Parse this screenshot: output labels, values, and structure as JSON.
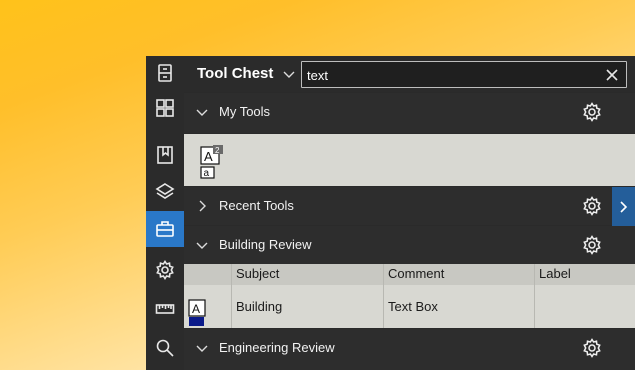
{
  "panel": {
    "title": "Tool Chest",
    "search": {
      "value": "text",
      "placeholder": ""
    }
  },
  "rail": {
    "items": [
      {
        "icon": "file-cabinet-icon"
      },
      {
        "icon": "thumbnails-icon"
      },
      {
        "icon": "bookmarks-icon"
      },
      {
        "icon": "layers-icon"
      },
      {
        "icon": "toolbox-icon",
        "active": true
      },
      {
        "icon": "properties-gear-icon"
      },
      {
        "icon": "measure-ruler-icon"
      },
      {
        "icon": "search-icon"
      }
    ]
  },
  "sections": {
    "my_tools": {
      "label": "My Tools",
      "expanded": true
    },
    "recent_tools": {
      "label": "Recent Tools",
      "expanded": false
    },
    "building_review": {
      "label": "Building Review",
      "expanded": true
    },
    "engineering_review": {
      "label": "Engineering Review",
      "expanded": true
    }
  },
  "table": {
    "columns": [
      "",
      "Subject",
      "Comment",
      "Label"
    ],
    "rows": [
      {
        "subject": "Building",
        "comment": "Text Box",
        "label": ""
      }
    ]
  },
  "colors": {
    "accent": "#2a78c8",
    "panel_bg": "#2a2a2a",
    "content_bg": "#d8d8d2"
  }
}
